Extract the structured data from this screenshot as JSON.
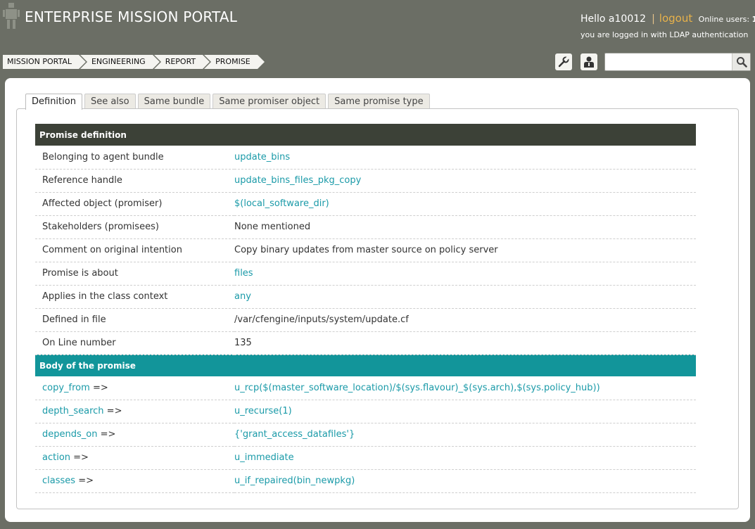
{
  "header": {
    "title": "ENTERPRISE MISSION PORTAL",
    "greeting": "Hello a10012",
    "separator": "|",
    "logout": "logout",
    "online_label": "Online users:",
    "online_count": "1",
    "auth_text": "you are logged in with LDAP authentication"
  },
  "breadcrumb": [
    "MISSION PORTAL",
    "ENGINEERING",
    "REPORT",
    "PROMISE"
  ],
  "toolbar": {
    "wrench_icon": "wrench-icon",
    "user_icon": "user-icon",
    "search_icon": "search-icon",
    "search_value": ""
  },
  "tabs": [
    {
      "label": "Definition",
      "active": true
    },
    {
      "label": "See also",
      "active": false
    },
    {
      "label": "Same bundle",
      "active": false
    },
    {
      "label": "Same promiser object",
      "active": false
    },
    {
      "label": "Same promise type",
      "active": false
    }
  ],
  "definition": {
    "heading": "Promise definition",
    "rows": [
      {
        "key": "Belonging to agent bundle",
        "value": "update_bins",
        "link": true
      },
      {
        "key": "Reference handle",
        "value": "update_bins_files_pkg_copy",
        "link": true
      },
      {
        "key": "Affected object (promiser)",
        "value": "$(local_software_dir)",
        "link": true
      },
      {
        "key": "Stakeholders (promisees)",
        "value": "None mentioned",
        "link": false
      },
      {
        "key": "Comment on original intention",
        "value": "Copy binary updates from master source on policy server",
        "link": false
      },
      {
        "key": "Promise is about",
        "value": "files",
        "link": true
      },
      {
        "key": "Applies in the class context",
        "value": "any",
        "link": true
      },
      {
        "key": "Defined in file",
        "value": "/var/cfengine/inputs/system/update.cf",
        "link": false
      },
      {
        "key": "On Line number",
        "value": "135",
        "link": false
      }
    ]
  },
  "body": {
    "heading": "Body of the promise",
    "arrow": "=>",
    "rows": [
      {
        "key": "copy_from",
        "value": "u_rcp($(master_software_location)/$(sys.flavour)_$(sys.arch),$(sys.policy_hub))"
      },
      {
        "key": "depth_search",
        "value": "u_recurse(1)"
      },
      {
        "key": "depends_on",
        "value": "{'grant_access_datafiles'}"
      },
      {
        "key": "action",
        "value": "u_immediate"
      },
      {
        "key": "classes",
        "value": "u_if_repaired(bin_newpkg)"
      }
    ]
  }
}
